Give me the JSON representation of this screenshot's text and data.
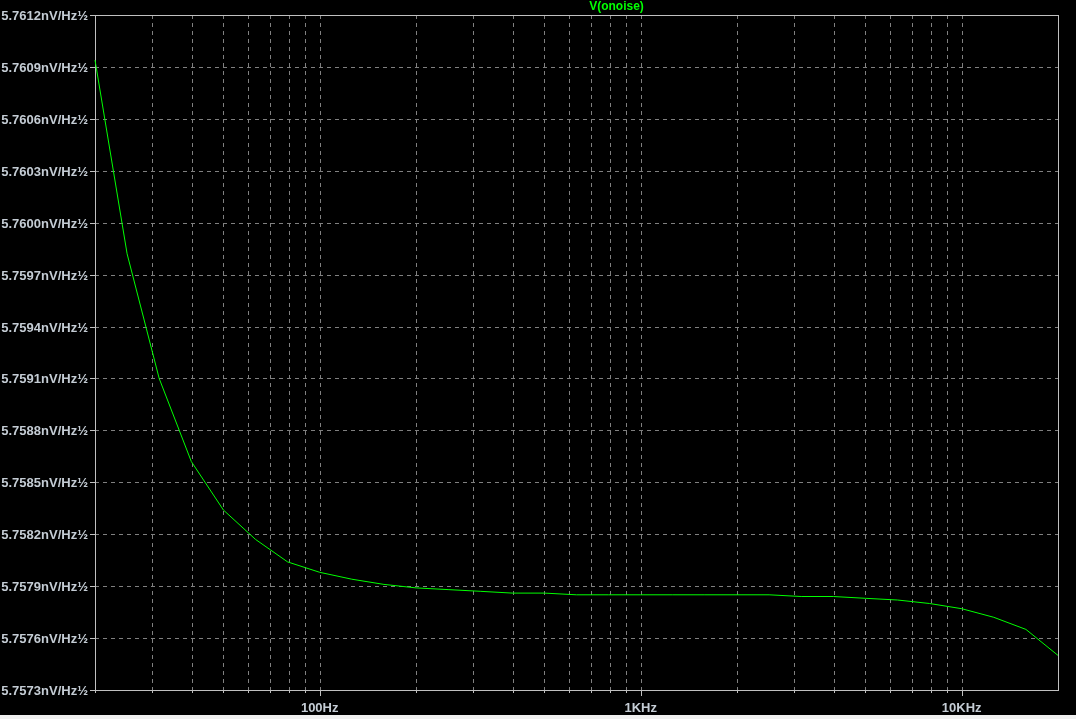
{
  "plot": {
    "chart_data": {
      "type": "line",
      "grid": true,
      "categories": [
        null,
        null,
        null,
        null,
        null,
        null,
        null,
        "100Hz",
        null,
        null,
        null,
        null,
        null,
        null,
        null,
        null,
        null,
        "1KHz",
        null,
        null,
        null,
        null,
        null,
        null,
        null,
        null,
        null,
        "10KHz",
        null,
        null,
        null
      ],
      "series": [
        {
          "name": "V(onoise)",
          "color": "#00ff00",
          "values": [
            5.76094,
            5.75982,
            5.7591,
            5.75862,
            5.75834,
            5.75817,
            5.75804,
            5.75798,
            5.75794,
            5.75791,
            5.75789,
            5.75788,
            5.75787,
            5.75786,
            5.75786,
            5.75785,
            5.75785,
            5.75785,
            5.75785,
            5.75785,
            5.75785,
            5.75785,
            5.75784,
            5.75784,
            5.75783,
            5.75782,
            5.7578,
            5.75777,
            5.75772,
            5.75765,
            5.7575
          ]
        }
      ],
      "ylim": [
        5.7573,
        5.7612
      ],
      "yticks": [
        {
          "value": 5.7612,
          "label": "5.7612nV/Hz½"
        },
        {
          "value": 5.7609,
          "label": "5.7609nV/Hz½"
        },
        {
          "value": 5.7606,
          "label": "5.7606nV/Hz½"
        },
        {
          "value": 5.7603,
          "label": "5.7603nV/Hz½"
        },
        {
          "value": 5.76,
          "label": "5.7600nV/Hz½"
        },
        {
          "value": 5.7597,
          "label": "5.7597nV/Hz½"
        },
        {
          "value": 5.7594,
          "label": "5.7594nV/Hz½"
        },
        {
          "value": 5.7591,
          "label": "5.7591nV/Hz½"
        },
        {
          "value": 5.7588,
          "label": "5.7588nV/Hz½"
        },
        {
          "value": 5.7585,
          "label": "5.7585nV/Hz½"
        },
        {
          "value": 5.7582,
          "label": "5.7582nV/Hz½"
        },
        {
          "value": 5.7579,
          "label": "5.7579nV/Hz½"
        },
        {
          "value": 5.7576,
          "label": "5.7576nV/Hz½"
        },
        {
          "value": 5.7573,
          "label": "5.7573nV/Hz½"
        }
      ]
    }
  }
}
